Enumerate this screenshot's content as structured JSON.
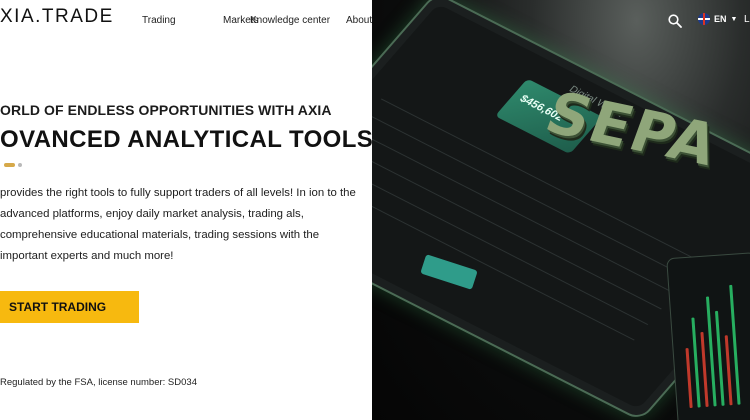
{
  "header": {
    "logo": "XIA.TRADE",
    "nav": [
      {
        "label": "Trading"
      },
      {
        "label": "Markets"
      },
      {
        "label": "Knowledge center"
      },
      {
        "label": "About"
      }
    ],
    "lang": "EN",
    "login": "L"
  },
  "hero": {
    "subtitle": "ORLD OF ENDLESS OPPORTUNITIES WITH AXIA",
    "title": "OVANCED ANALYTICAL TOOLS",
    "description": "provides the right tools to fully support traders of all levels! In ion to the advanced platforms, enjoy daily market analysis, trading als, comprehensive educational materials, trading sessions with the important experts and much more!",
    "cta": "START TRADING",
    "regulation": "Regulated by the FSA, license number: SD034"
  },
  "panel": {
    "wallet_title": "Digital Wallet",
    "balance": "$456,602",
    "banner": "SEPA"
  },
  "colors": {
    "accent": "#f7b90f",
    "dot_active": "#d6a94a",
    "panel_bg": "#070707",
    "teal": "#2f9c8a"
  }
}
